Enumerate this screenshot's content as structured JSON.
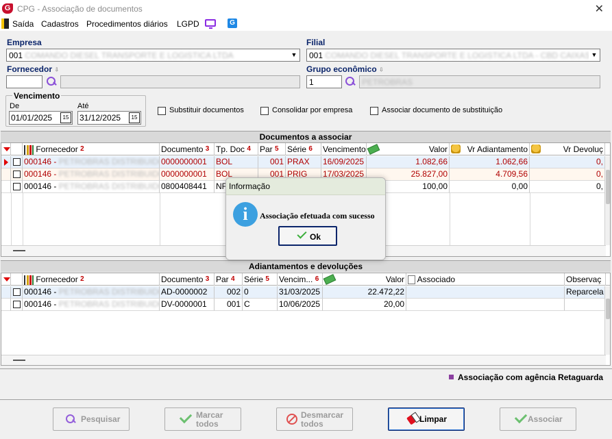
{
  "window": {
    "logo": "G",
    "title": "CPG - Associação de documentos",
    "close": "✕"
  },
  "menu": {
    "saida": "Saída",
    "cadastros": "Cadastros",
    "procedimentos": "Procedimentos diários",
    "lgpd": "LGPD",
    "g_icon": "G"
  },
  "empresa": {
    "label": "Empresa",
    "code": "001",
    "name": "COMANDO DIESEL TRANSPORTE E LOGISTICA LTDA"
  },
  "filial": {
    "label": "Filial",
    "code": "001",
    "name": "COMANDO DIESEL TRANSPORTE E LOGISTICA LTDA - CBD CAIXAS - PETRO"
  },
  "fornecedor": {
    "label": "Fornecedor",
    "sort_mark": "⇩",
    "code": "",
    "name": ""
  },
  "grupo": {
    "label": "Grupo econômico",
    "sort_mark": "⇩",
    "code": "1",
    "name": "PETROBRAS"
  },
  "vencimento": {
    "label": "Vencimento",
    "de_label": "De",
    "ate_label": "Até",
    "de": "01/01/2025",
    "ate": "31/12/2025",
    "cal_icon": "15"
  },
  "options": {
    "substituir": "Substituir documentos",
    "consolidar": "Consolidar por empresa",
    "associar_sub": "Associar documento de substituição"
  },
  "docs_section": {
    "title": "Documentos a associar",
    "headers": {
      "fornecedor": "Fornecedor",
      "documento": "Documento",
      "tp_doc": "Tp. Doc",
      "par": "Par",
      "serie": "Série",
      "vencimento": "Vencimento",
      "valor": "Valor",
      "vr_adiantamento": "Vr Adiantamento",
      "vr_devolucao": "Vr Devoluç"
    },
    "sort_numbers": {
      "fornecedor": "2",
      "documento": "3",
      "tp_doc": "4",
      "par": "5",
      "serie": "6"
    },
    "rows": [
      {
        "fornecedor": "000146 - ",
        "fornecedor_name": "PETROBRAS DISTRIBUIDORA",
        "documento": "0000000001",
        "tp_doc": "BOL",
        "par": "001",
        "serie": "PRAX",
        "vencimento": "16/09/2025",
        "valor": "1.082,66",
        "vr_adiantamento": "1.062,66",
        "vr_devolucao": "0,"
      },
      {
        "fornecedor": "000146 - ",
        "fornecedor_name": "PETROBRAS DISTRIBUIDORA",
        "documento": "0000000001",
        "tp_doc": "BOL",
        "par": "001",
        "serie": "PRIG",
        "vencimento": "17/03/2025",
        "valor": "25.827,00",
        "vr_adiantamento": "4.709,56",
        "vr_devolucao": "0,"
      },
      {
        "fornecedor": "000146 - ",
        "fornecedor_name": "PETROBRAS DISTRIBUIDORA",
        "documento": "0800408441",
        "tp_doc": "NF",
        "par": "",
        "serie": "",
        "vencimento": "",
        "valor": "100,00",
        "vr_adiantamento": "0,00",
        "vr_devolucao": "0,"
      }
    ]
  },
  "adiant_section": {
    "title": "Adiantamentos e devoluções",
    "headers": {
      "fornecedor": "Fornecedor",
      "documento": "Documento",
      "par": "Par",
      "serie": "Série",
      "vencimento": "Vencim...",
      "valor": "Valor",
      "associado": "Associado",
      "observacao": "Observaç"
    },
    "sort_numbers": {
      "fornecedor": "2",
      "documento": "3",
      "par": "4",
      "serie": "5",
      "vencimento": "6"
    },
    "rows": [
      {
        "fornecedor": "000146 - ",
        "fornecedor_name": "PETROBRAS DISTRIBUIDORA",
        "documento": "AD-0000002",
        "par": "002",
        "serie": "0",
        "vencimento": "31/03/2025",
        "valor": "22.472,22",
        "associado": "",
        "observacao": "Reparcela"
      },
      {
        "fornecedor": "000146 - ",
        "fornecedor_name": "PETROBRAS DISTRIBUIDORA",
        "documento": "DV-0000001",
        "par": "001",
        "serie": "C",
        "vencimento": "10/06/2025",
        "valor": "20,00",
        "associado": "",
        "observacao": ""
      }
    ]
  },
  "legend": {
    "text": "Associação com agência Retaguarda",
    "color": "#8b3fa0"
  },
  "buttons": {
    "pesquisar": "Pesquisar",
    "marcar_1": "Marcar",
    "marcar_2": "todos",
    "desmarcar_1": "Desmarcar",
    "desmarcar_2": "todos",
    "limpar": "Limpar",
    "associar": "Associar"
  },
  "dialog": {
    "title": "Informação",
    "icon": "i",
    "message": "Associação efetuada com sucesso",
    "ok": "Ok"
  }
}
